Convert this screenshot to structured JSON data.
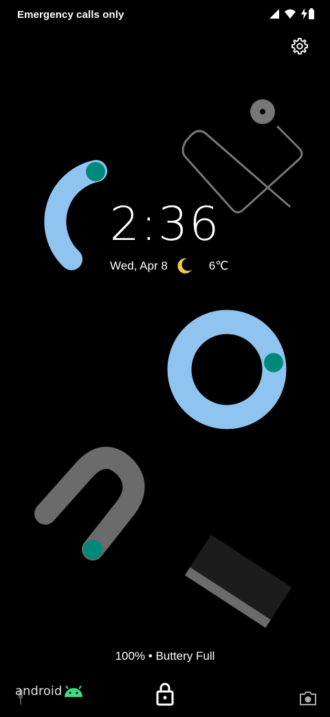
{
  "status_bar": {
    "carrier_text": "Emergency calls only",
    "icons": [
      "signal-icon",
      "wifi-icon",
      "battery-charging-icon"
    ]
  },
  "settings": {
    "icon": "gear-icon"
  },
  "clock": {
    "time": "2:36",
    "date": "Wed, Apr 8",
    "weather_icon": "moon-icon",
    "temperature": "6℃"
  },
  "charging": {
    "text": "100% • Buttery Full"
  },
  "bottom": {
    "brand": "android",
    "lock_icon": "lock-icon",
    "camera_icon": "camera-icon"
  },
  "colors": {
    "background": "#000000",
    "light_blue": "#8ec4ef",
    "teal": "#00897b",
    "grey": "#6b6b6b",
    "moon": "#f2c94c",
    "android_green": "#3ddc84"
  }
}
